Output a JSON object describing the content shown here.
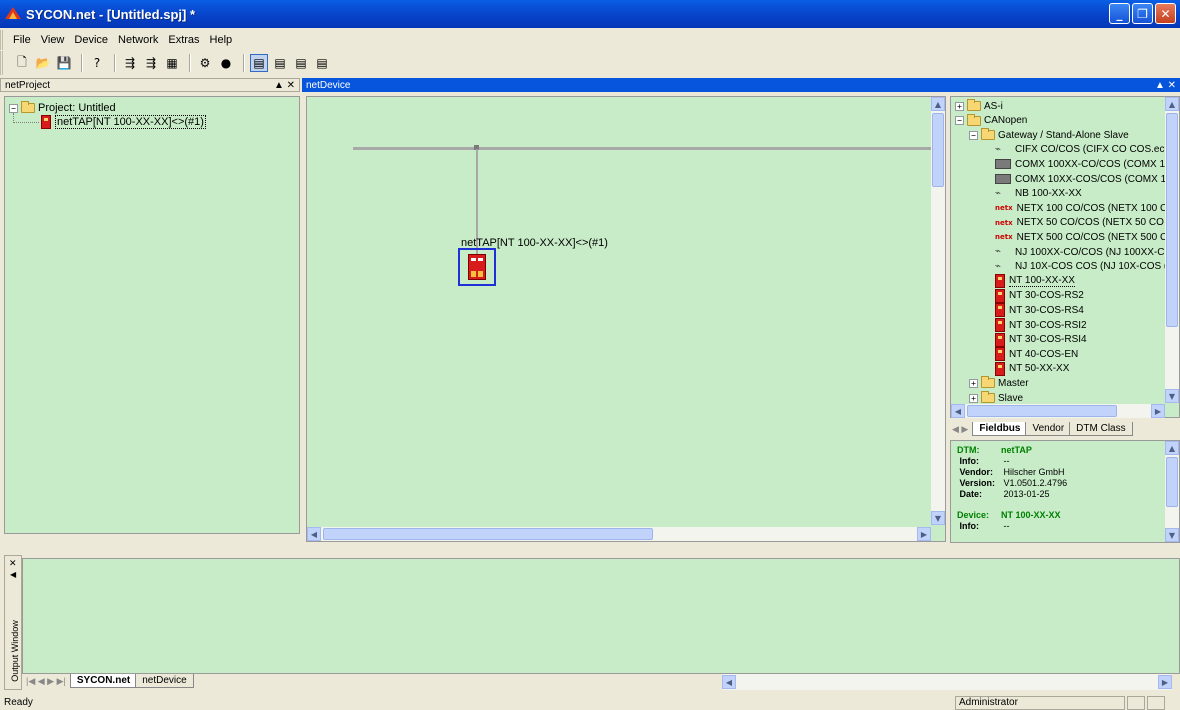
{
  "window": {
    "title": "SYCON.net - [Untitled.spj] *"
  },
  "menu": {
    "file": "File",
    "view": "View",
    "device": "Device",
    "network": "Network",
    "extras": "Extras",
    "help": "Help"
  },
  "panels": {
    "left_title": "netProject",
    "main_title": "netDevice"
  },
  "project_tree": {
    "root": "Project: Untitled",
    "device": "netTAP[NT 100-XX-XX]<>(#1)"
  },
  "canvas": {
    "device_label": "netTAP[NT 100-XX-XX]<>(#1)"
  },
  "catalog": {
    "items": [
      {
        "label": "AS-i"
      },
      {
        "label": "CANopen"
      },
      {
        "label": "Gateway / Stand-Alone Slave"
      },
      {
        "label": "CIFX CO/COS (CIFX CO COS.ec"
      },
      {
        "label": "COMX 100XX-CO/COS (COMX 1("
      },
      {
        "label": "COMX 10XX-COS/COS (COMX 1("
      },
      {
        "label": "NB 100-XX-XX"
      },
      {
        "label": "NETX 100 CO/COS (NETX 100 C"
      },
      {
        "label": "NETX 50 CO/COS (NETX 50 CO ("
      },
      {
        "label": "NETX 500 CO/COS (NETX 500 C"
      },
      {
        "label": "NJ 100XX-CO/COS (NJ 100XX-C"
      },
      {
        "label": "NJ 10X-COS COS (NJ 10X-COS ("
      },
      {
        "label": "NT 100-XX-XX"
      },
      {
        "label": "NT 30-COS-RS2"
      },
      {
        "label": "NT 30-COS-RS4"
      },
      {
        "label": "NT 30-COS-RSI2"
      },
      {
        "label": "NT 30-COS-RSI4"
      },
      {
        "label": "NT 40-COS-EN"
      },
      {
        "label": "NT 50-XX-XX"
      },
      {
        "label": "Master"
      },
      {
        "label": "Slave"
      }
    ],
    "tabs": {
      "fieldbus": "Fieldbus",
      "vendor": "Vendor",
      "dtm_class": "DTM Class"
    }
  },
  "info": {
    "dtm_key": "DTM:",
    "dtm_val": "netTAP",
    "info_key": "Info:",
    "info_val": "--",
    "vendor_key": "Vendor:",
    "vendor_val": "Hilscher GmbH",
    "version_key": "Version:",
    "version_val": "V1.0501.2.4796",
    "date_key": "Date:",
    "date_val": "2013-01-25",
    "device_key": "Device:",
    "device_val": "NT 100-XX-XX",
    "info2_key": "Info:",
    "info2_val": "--"
  },
  "output": {
    "label": "Output Window",
    "tab1": "SYCON.net",
    "tab2": "netDevice"
  },
  "status": {
    "left": "Ready",
    "user": "Administrator"
  }
}
